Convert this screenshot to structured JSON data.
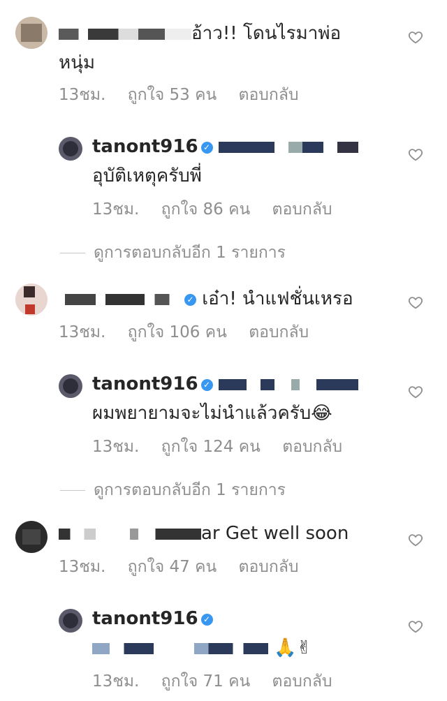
{
  "comments": [
    {
      "text_line1": "อ้าว!! โดนไรมาพ่อ",
      "text_line2": "หนุ่ม",
      "time": "13ชม.",
      "likes": "ถูกใจ 53 คน",
      "reply": "ตอบกลับ"
    },
    {
      "username": "tanont916",
      "text": "อุบัติเหตุครับพี่",
      "time": "13ชม.",
      "likes": "ถูกใจ 86 คน",
      "reply": "ตอบกลับ"
    },
    {
      "view_more": "ดูการตอบกลับอีก 1 รายการ"
    },
    {
      "text": "เอ๋า! นำแฟชั่นเหรอ",
      "time": "13ชม.",
      "likes": "ถูกใจ 106 คน",
      "reply": "ตอบกลับ"
    },
    {
      "username": "tanont916",
      "text": "ผมพยายามจะไม่นำแล้วครับ",
      "emoji": "😂",
      "time": "13ชม.",
      "likes": "ถูกใจ 124 คน",
      "reply": "ตอบกลับ"
    },
    {
      "view_more": "ดูการตอบกลับอีก 1 รายการ"
    },
    {
      "text": "ar Get well soon",
      "time": "13ชม.",
      "likes": "ถูกใจ 47 คน",
      "reply": "ตอบกลับ"
    },
    {
      "username": "tanont916",
      "emoji": "🙏✌",
      "time": "13ชม.",
      "likes": "ถูกใจ 71 คน",
      "reply": "ตอบกลับ"
    }
  ],
  "colors": {
    "text": "#262626",
    "meta": "#8e8e8e",
    "verified": "#3897f0"
  },
  "icons": [
    "heart-icon",
    "verified-badge-icon"
  ]
}
